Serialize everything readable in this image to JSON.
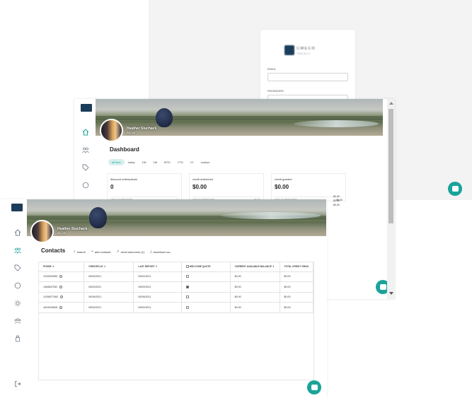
{
  "login": {
    "brand_mark_text": "CMECR",
    "brand_sub_text": "TIDE ALLY",
    "email_label": "EMAIL",
    "password_label": "PASSWORD"
  },
  "dashboard": {
    "user_name": "Heather Stuchack",
    "user_sub": "Alc_ob",
    "title": "Dashboard",
    "ranges": [
      "all time",
      "today",
      "1W",
      "1M",
      "MTD",
      "YTD",
      "1Y",
      "custom"
    ],
    "active_range": "all time",
    "cards": [
      {
        "label": "discount redemptions",
        "value": "0",
        "row_label": "NEW CUSTOMERS",
        "row_value": "0"
      },
      {
        "label": "credit redeemed",
        "value": "$0.00",
        "row_label": "NEW CUSTOMERS",
        "row_value": "$0.00"
      },
      {
        "label": "credit granted",
        "value": "$0.00",
        "row_label": "NEW CUSTOMERS",
        "row_value": "$0.00"
      }
    ],
    "extra_values": [
      "$0.00",
      "$0.00",
      "$0.00"
    ]
  },
  "contacts": {
    "user_name": "Heather Stuchack",
    "user_sub": "Alc_ob",
    "title": "Contacts",
    "toolbar": {
      "search": "search",
      "add": "add contacts",
      "send": "send welcomes (1)",
      "download": "download csv"
    },
    "columns": [
      "PHONE ▼",
      "CREATED AT ⇕",
      "LAST REPORT ⇕",
      "WELCOME QUOTE",
      "CURRENT AVAILABLE BALANCE ⇕",
      "TOTAL CREDIT GRAN"
    ],
    "rows": [
      {
        "phone": "1315253985",
        "created": "09/02/2021",
        "last": "09/02/2021",
        "welcome": false,
        "balance": "$0.00",
        "credit": "$0.00"
      },
      {
        "phone": "1484847052",
        "created": "09/02/2021",
        "last": "09/02/2021",
        "welcome": true,
        "balance": "$0.00",
        "credit": "$0.00"
      },
      {
        "phone": "1/206577083",
        "created": "09/26/2021",
        "last": "09/26/2021",
        "welcome": false,
        "balance": "$0.00",
        "credit": "$0.00"
      },
      {
        "phone": "1819916638",
        "created": "09/02/2021",
        "last": "09/02/2021",
        "welcome": false,
        "balance": "$0.00",
        "credit": "$0.00"
      }
    ]
  },
  "colors": {
    "accent": "#1aa39a",
    "navy": "#1c3d5a"
  },
  "icons": [
    "home-icon",
    "people-icon",
    "tag-icon",
    "chat-icon",
    "settings-icon",
    "group-icon",
    "bottle-icon",
    "logout-icon",
    "search-icon",
    "plus-icon",
    "send-icon",
    "download-icon"
  ]
}
